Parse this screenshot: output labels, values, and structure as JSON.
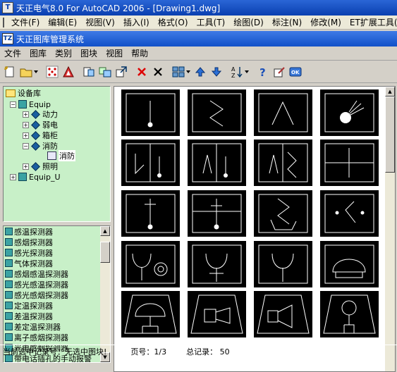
{
  "window": {
    "title": "天正电气8.0 For AutoCAD 2006 - [Drawing1.dwg]",
    "menu": [
      "文件(F)",
      "编辑(E)",
      "视图(V)",
      "插入(I)",
      "格式(O)",
      "工具(T)",
      "绘图(D)",
      "标注(N)",
      "修改(M)",
      "ET扩展工具(X)"
    ]
  },
  "dialog": {
    "title": "天正图库管理系统",
    "menu": [
      "文件",
      "图库",
      "类别",
      "图块",
      "视图",
      "帮助"
    ]
  },
  "tree": {
    "root": "设备库",
    "equip": "Equip",
    "children": [
      "动力",
      "弱电",
      "箱柜",
      "消防",
      "照明"
    ],
    "selected_leaf": "消防",
    "equip_u": "Equip_U"
  },
  "list": {
    "items": [
      "感温探测器",
      "感烟探测器",
      "感光探测器",
      "气体探测器",
      "感烟感温探测器",
      "感光感温探测器",
      "感光感烟探测器",
      "定温探测器",
      "差温探测器",
      "差定温探测器",
      "离子感烟探测器",
      "光电感烟探测器",
      "带电话插孔的手动报警"
    ]
  },
  "status": {
    "selection": "当前选中记录号：无选中图块!",
    "page": "页号：1/3",
    "total": "总记录： 50"
  },
  "icons": {
    "app": "autocad-app-icon",
    "dialog": "tangent-logo-icon"
  },
  "colors": {
    "titlebar": "#0a3fb0",
    "panel_bg": "#c8f0c8",
    "symbol_bg": "#000000",
    "symbol_line": "#ffffff"
  }
}
